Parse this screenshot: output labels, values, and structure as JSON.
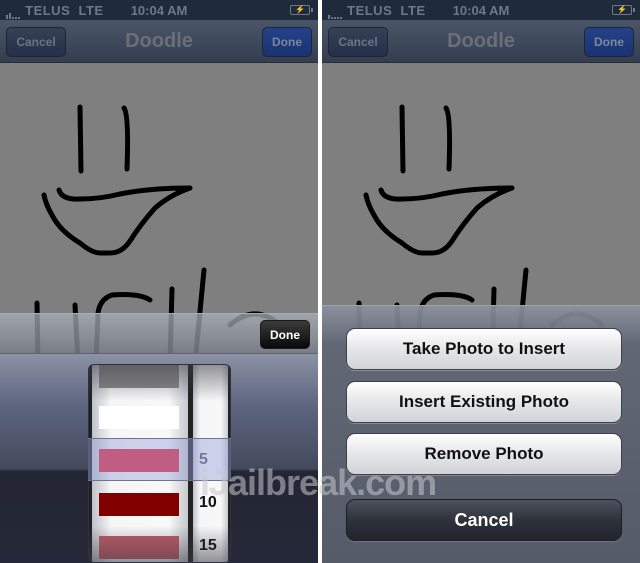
{
  "screens": [
    {
      "status_bar": {
        "carrier": "TELUS",
        "network": "LTE",
        "time": "10:04 AM",
        "battery_icon": "charging-battery-icon"
      },
      "nav": {
        "title": "Doodle",
        "cancel_label": "Cancel",
        "done_label": "Done"
      },
      "drawing": {
        "strokes_description": "hand-drawn smiley face and the word HELLO",
        "ink_color": "#000000",
        "background_color": "#7f7f7f"
      },
      "picker": {
        "done_label": "Done",
        "color_options": [
          "#8a8a8a",
          "#ffffff",
          "#e0283c",
          "#800000",
          "#c05a66"
        ],
        "selected_color": "#e0283c",
        "size_options": [
          "5",
          "10",
          "15"
        ],
        "selected_size": "5"
      }
    },
    {
      "status_bar": {
        "carrier": "TELUS",
        "network": "LTE",
        "time": "10:04 AM",
        "battery_icon": "charging-battery-icon"
      },
      "nav": {
        "title": "Doodle",
        "cancel_label": "Cancel",
        "done_label": "Done"
      },
      "action_sheet": {
        "buttons": [
          "Take Photo to Insert",
          "Insert Existing Photo",
          "Remove Photo"
        ],
        "cancel_label": "Cancel"
      }
    }
  ],
  "watermark": "iJailbreak.com"
}
